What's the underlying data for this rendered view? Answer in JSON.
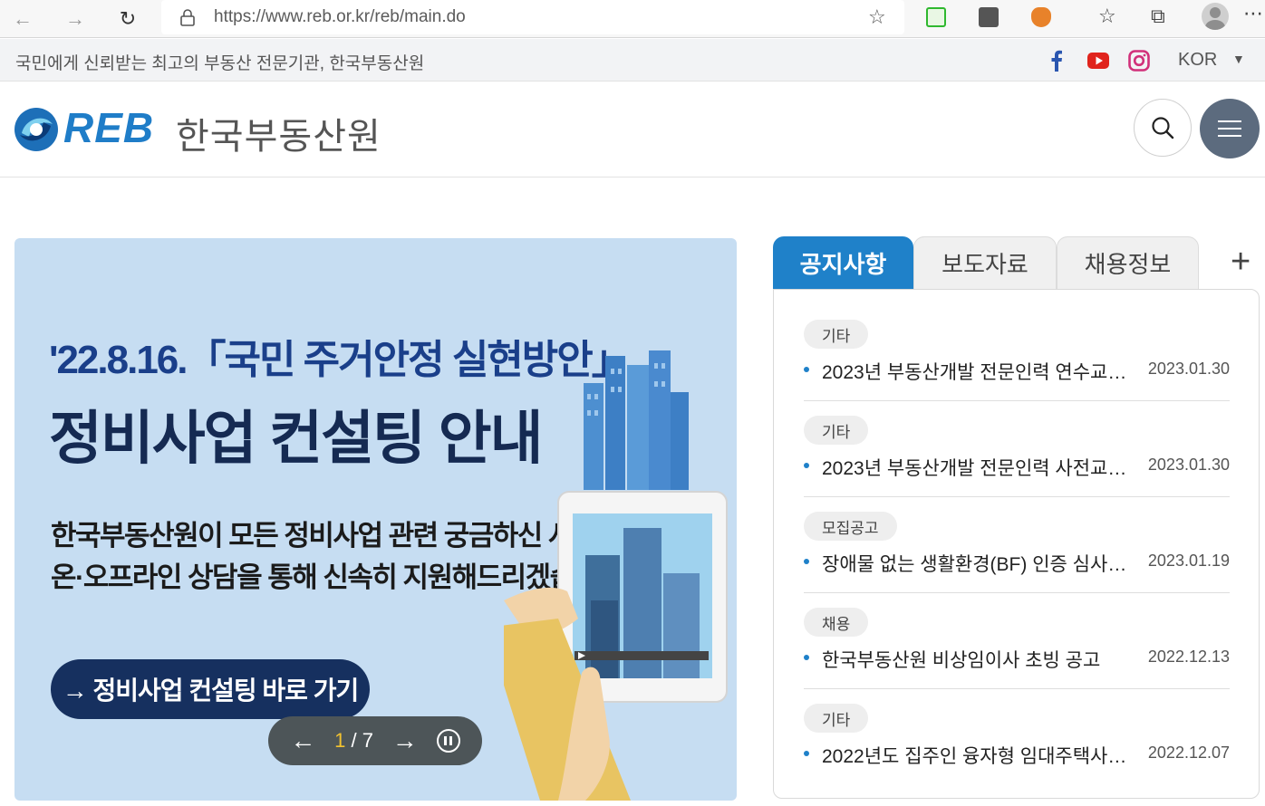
{
  "browser": {
    "url": "https://www.reb.or.kr/reb/main.do"
  },
  "utility": {
    "tagline": "국민에게 신뢰받는 최고의 부동산 전문기관, 한국부동산원",
    "language": "KOR"
  },
  "header": {
    "logo_en": "REB",
    "logo_ko": "한국부동산원"
  },
  "banner": {
    "title_line1": "'22.8.16.「국민 주거안정 실현방안」",
    "title_line2": "정비사업 컨설팅 안내",
    "desc_line1": "한국부동산원이 모든 정비사업 관련 궁금하신 사항을",
    "desc_line2": "온·오프라인 상담을 통해 신속히 지원해드리겠습니다.",
    "cta": "→ 정비사업 컨설팅 바로 가기",
    "pager_current": "1",
    "pager_sep": " / ",
    "pager_total": "7"
  },
  "notice": {
    "tabs": [
      "공지사항",
      "보도자료",
      "채용정보"
    ],
    "items": [
      {
        "category": "기타",
        "title": "2023년 부동산개발 전문인력 연수교…",
        "date": "2023.01.30"
      },
      {
        "category": "기타",
        "title": "2023년 부동산개발 전문인력 사전교…",
        "date": "2023.01.30"
      },
      {
        "category": "모집공고",
        "title": "장애물 없는 생활환경(BF) 인증 심사, …",
        "date": "2023.01.19"
      },
      {
        "category": "채용",
        "title": "한국부동산원 비상임이사 초빙 공고",
        "date": "2022.12.13"
      },
      {
        "category": "기타",
        "title": "2022년도 집주인 융자형 임대주택사…",
        "date": "2022.12.07"
      }
    ]
  },
  "colors": {
    "brand_blue": "#1f81c9",
    "banner_bg": "#c6ddf2",
    "cta_navy": "#16305f",
    "menu_btn": "#5c6b7e"
  },
  "icons": {
    "social": [
      "facebook-icon",
      "youtube-icon",
      "instagram-icon"
    ]
  }
}
